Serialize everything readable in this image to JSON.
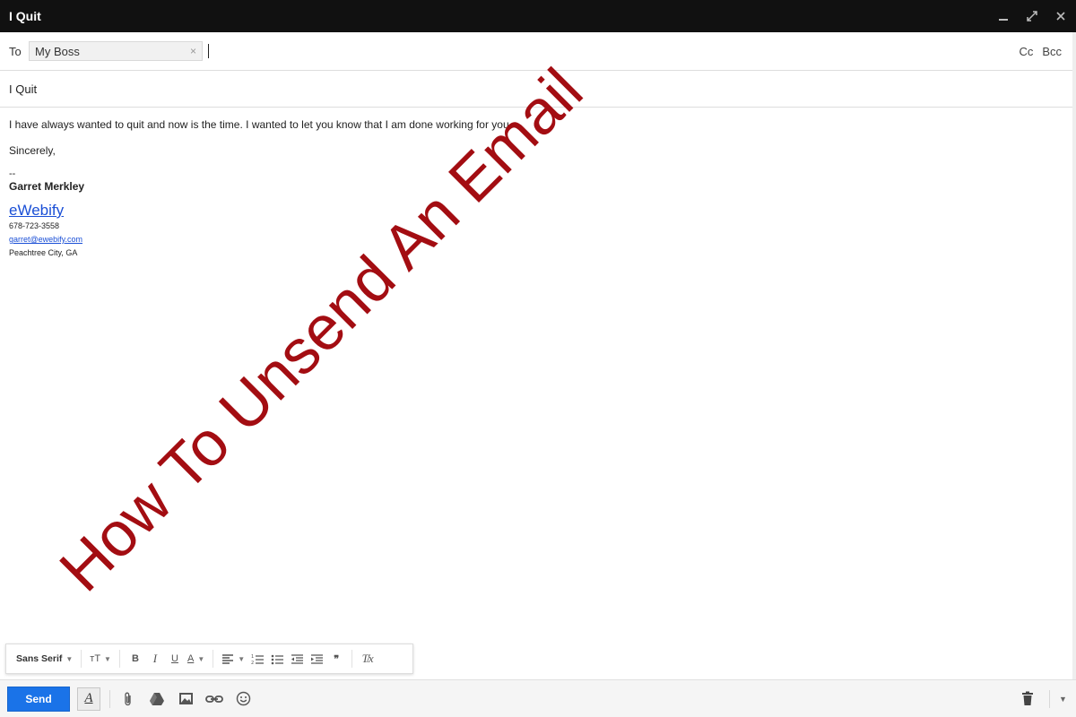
{
  "window": {
    "title": "I Quit",
    "controls": [
      "minimize-icon",
      "popout-icon",
      "close-icon"
    ]
  },
  "recipients": {
    "to_label": "To",
    "chips": [
      {
        "name": "My Boss",
        "remove": "×"
      }
    ],
    "cc": "Cc",
    "bcc": "Bcc"
  },
  "subject": "I Quit",
  "body": {
    "line1": "I have always wanted to quit and now is the time.  I wanted to let you know that I am done working for you.",
    "closing": "Sincerely,",
    "sig_separator": "--",
    "sig_name": "Garret Merkley",
    "sig_link": "eWebify",
    "sig_phone": "678-723-3558",
    "sig_email": "garret@ewebify.com",
    "sig_location": "Peachtree City, GA"
  },
  "overlay_text": "How To Unsend An Email",
  "format_toolbar": {
    "font": "Sans Serif",
    "size_glyph": "тT",
    "bold": "B",
    "italic": "I",
    "underline": "U",
    "text_color": "A",
    "quote": "❞",
    "clear": "T̸x"
  },
  "bottom_bar": {
    "send": "Send",
    "format_toggle": "A"
  },
  "colors": {
    "send_blue": "#1a73e8",
    "overlay_red": "#a30d12",
    "link_blue": "#1a4fd6",
    "titlebar": "#111111"
  }
}
